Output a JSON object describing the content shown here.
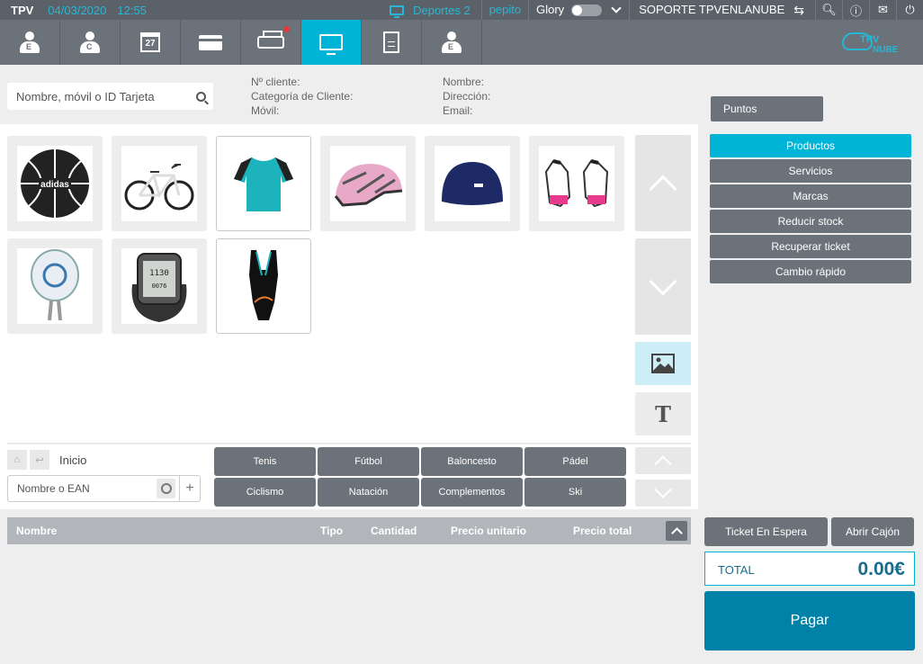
{
  "topbar": {
    "app": "TPV",
    "date": "04/03/2020",
    "time": "12:55",
    "store": "Deportes 2",
    "user": "pepito",
    "drawer_label": "Glory",
    "support": "SOPORTE TPVENLANUBE"
  },
  "toolbar": {
    "items": [
      {
        "icon": "customer-e-icon",
        "letter": "E"
      },
      {
        "icon": "customer-c-icon",
        "letter": "C"
      },
      {
        "icon": "calendar-icon",
        "day": "27"
      },
      {
        "icon": "card-icon"
      },
      {
        "icon": "cash-drawer-icon",
        "notification": true
      },
      {
        "icon": "monitor-icon",
        "active": true
      },
      {
        "icon": "document-icon"
      },
      {
        "icon": "employee-exit-icon",
        "letter": "E"
      }
    ],
    "logo": {
      "line1": "TPV",
      "line2": "NUBE"
    }
  },
  "customer": {
    "search_placeholder": "Nombre, móvil o ID Tarjeta",
    "client_no_label": "Nº cliente:",
    "category_label": "Categoría de Cliente:",
    "mobile_label": "Móvil:",
    "name_label": "Nombre:",
    "address_label": "Dirección:",
    "email_label": "Email:",
    "points_button": "Puntos"
  },
  "products": [
    {
      "name": "basketball",
      "selected": false
    },
    {
      "name": "bicycle",
      "selected": false
    },
    {
      "name": "t-shirt",
      "selected": true
    },
    {
      "name": "helmet",
      "selected": false
    },
    {
      "name": "swim-cap",
      "selected": false
    },
    {
      "name": "goalkeeper-gloves",
      "selected": false
    },
    {
      "name": "padel-racket",
      "selected": false
    },
    {
      "name": "sport-watch",
      "selected": true
    },
    {
      "name": "swimsuit",
      "selected": true
    }
  ],
  "nav": {
    "breadcrumb": "Inicio",
    "ean_placeholder": "Nombre o EAN",
    "text_mode": "T"
  },
  "categories": [
    "Tenis",
    "Fútbol",
    "Baloncesto",
    "Pádel",
    "Ciclismo",
    "Natación",
    "Complementos",
    "Ski"
  ],
  "menu": [
    "Productos",
    "Servicios",
    "Marcas",
    "Reducir stock",
    "Recuperar ticket",
    "Cambio rápido"
  ],
  "menu_active": "Productos",
  "ticket": {
    "columns": [
      "Nombre",
      "Tipo",
      "Cantidad",
      "Precio unitario",
      "Precio total"
    ],
    "rows": []
  },
  "actions": {
    "hold": "Ticket En Espera",
    "open_drawer": "Abrir Cajón",
    "total_label": "TOTAL",
    "total_value": "0.00€",
    "pay": "Pagar"
  },
  "colors": {
    "accent": "#00b4d8",
    "dark": "#6c727a",
    "pay": "#0082a8"
  }
}
